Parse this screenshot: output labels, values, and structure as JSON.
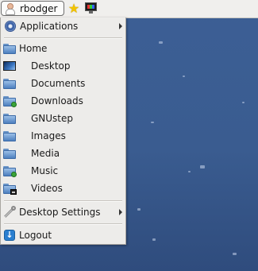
{
  "panel": {
    "username": "rbodger",
    "icons": [
      "user-avatar-icon",
      "star-icon",
      "monitor-icon"
    ]
  },
  "menu": {
    "applications": {
      "label": "Applications",
      "icon": "gear-icon",
      "has_submenu": true
    },
    "home": {
      "label": "Home",
      "icon": "folder-icon"
    },
    "places": [
      {
        "label": "Desktop",
        "icon": "desktop-icon"
      },
      {
        "label": "Documents",
        "icon": "folder-icon"
      },
      {
        "label": "Downloads",
        "icon": "folder-download-icon"
      },
      {
        "label": "GNUstep",
        "icon": "folder-icon"
      },
      {
        "label": "Images",
        "icon": "folder-icon"
      },
      {
        "label": "Media",
        "icon": "folder-icon"
      },
      {
        "label": "Music",
        "icon": "folder-music-icon"
      },
      {
        "label": "Videos",
        "icon": "folder-video-icon"
      }
    ],
    "desktop_settings": {
      "label": "Desktop Settings",
      "icon": "wrench-icon",
      "has_submenu": true
    },
    "logout": {
      "label": "Logout",
      "icon": "logout-icon"
    }
  },
  "colors": {
    "desktop_bg": "#3a5c90",
    "menu_bg": "#edecea",
    "panel_bg": "#f0efed",
    "folder_blue": "#4d7fbf"
  }
}
